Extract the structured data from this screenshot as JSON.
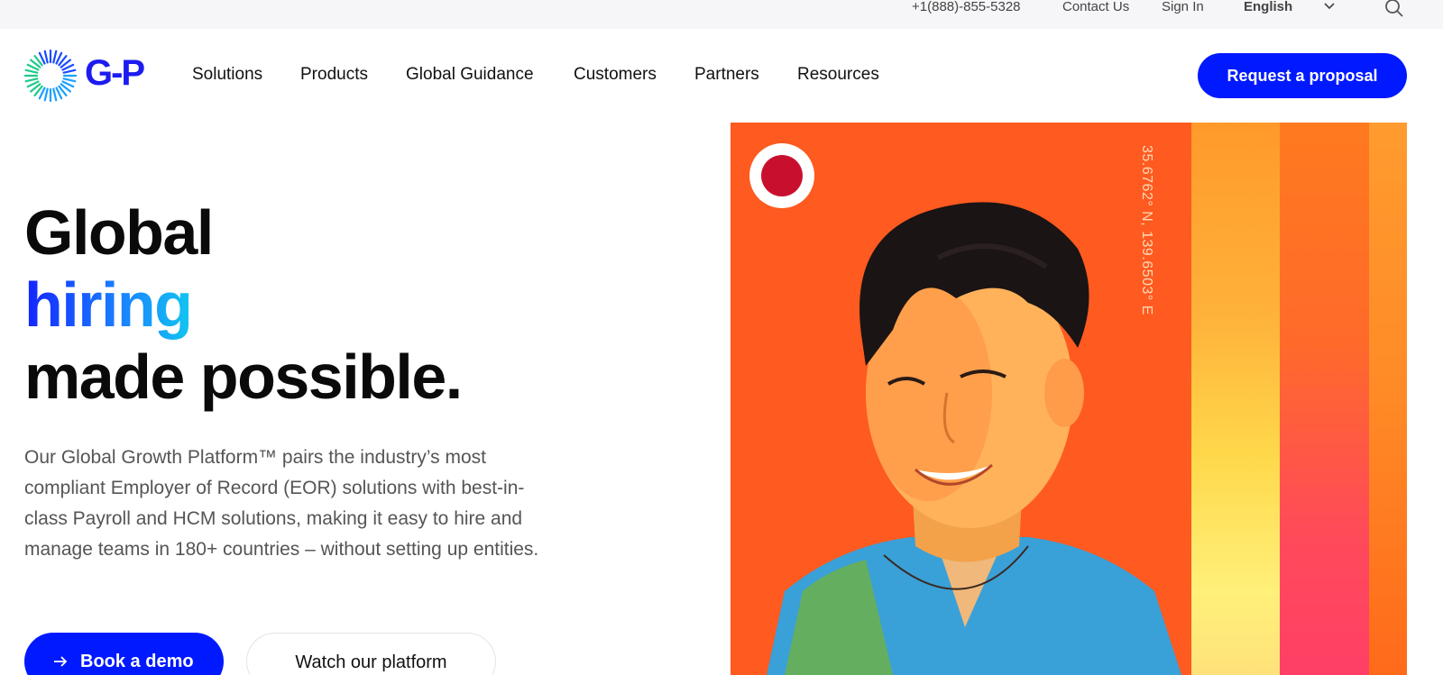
{
  "utility": {
    "phone": "+1(888)-855-5328",
    "contact": "Contact Us",
    "signin": "Sign In",
    "language": "English"
  },
  "nav": {
    "logo_text": "G-P",
    "items": [
      "Solutions",
      "Products",
      "Global Guidance",
      "Customers",
      "Partners",
      "Resources"
    ],
    "cta": "Request a proposal"
  },
  "hero": {
    "title_line1": "Global",
    "title_highlight": "hiring",
    "title_line3": "made possible.",
    "description": "Our Global Growth Platform™ pairs the industry’s most compliant Employer of Record (EOR) solutions with best-in-class Payroll and HCM solutions, making it easy to hire and manage teams in 180+ countries – without setting up entities.",
    "btn_demo": "Book a demo",
    "btn_watch": "Watch our platform"
  },
  "image": {
    "coordinates": "35.6762° N, 139.6503° E"
  },
  "colors": {
    "brand_blue": "#0019ff",
    "hero_orange": "#ff5a1f",
    "japan_red": "#c8102e"
  },
  "icons": [
    "chevron-down-icon",
    "search-icon",
    "arrow-right-icon",
    "gp-logo-icon"
  ]
}
